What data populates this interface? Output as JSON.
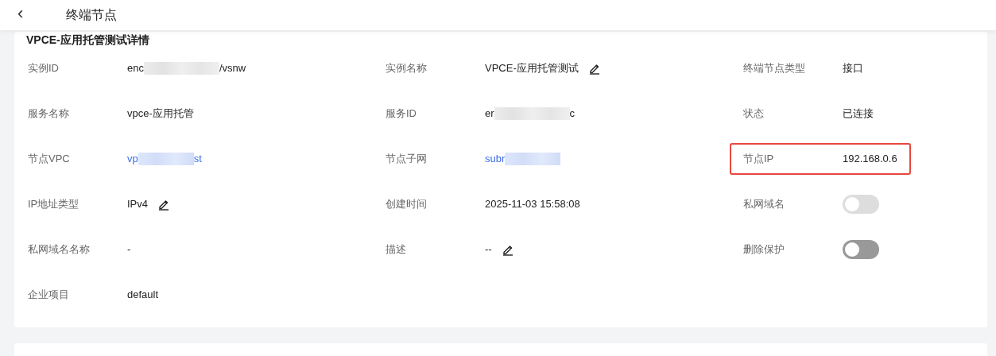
{
  "header": {
    "back_icon": "‹",
    "title": "终端节点"
  },
  "card": {
    "title": "VPCE-应用托管测试详情",
    "fields": [
      {
        "label": "实例ID",
        "kind": "masked",
        "value": "enc",
        "value_end": "/vsnw",
        "editable": false,
        "highlighted": false
      },
      {
        "label": "实例名称",
        "kind": "text",
        "value": "VPCE-应用托管测试",
        "editable": true,
        "highlighted": false
      },
      {
        "label": "终端节点类型",
        "kind": "text",
        "value": "接口",
        "editable": false,
        "highlighted": false
      },
      {
        "label": "服务名称",
        "kind": "text",
        "value": "vpce-应用托管",
        "editable": false,
        "highlighted": false
      },
      {
        "label": "服务ID",
        "kind": "masked",
        "value": "er",
        "value_end": "c",
        "editable": false,
        "highlighted": false
      },
      {
        "label": "状态",
        "kind": "text",
        "value": "已连接",
        "editable": false,
        "highlighted": false
      },
      {
        "label": "节点VPC",
        "kind": "masked_link",
        "value": "vp",
        "value_end": "st",
        "editable": false,
        "highlighted": false
      },
      {
        "label": "节点子网",
        "kind": "masked_link",
        "value": "subr",
        "editable": false,
        "highlighted": false
      },
      {
        "label": "节点IP",
        "kind": "text",
        "value": "192.168.0.6",
        "editable": false,
        "highlighted": true
      },
      {
        "label": "IP地址类型",
        "kind": "text",
        "value": "IPv4",
        "editable": true,
        "highlighted": false
      },
      {
        "label": "创建时间",
        "kind": "text",
        "value": "2025-11-03 15:58:08",
        "editable": false,
        "highlighted": false
      },
      {
        "label": "私网域名",
        "kind": "toggle",
        "on": false,
        "disabled": true,
        "highlighted": false
      },
      {
        "label": "私网域名名称",
        "kind": "text",
        "value": "-",
        "editable": false,
        "highlighted": false
      },
      {
        "label": "描述",
        "kind": "text",
        "value": "--",
        "editable": true,
        "highlighted": false
      },
      {
        "label": "删除保护",
        "kind": "toggle",
        "on": false,
        "disabled": false,
        "highlighted": false
      },
      {
        "label": "企业项目",
        "kind": "text",
        "value": "default",
        "editable": false,
        "highlighted": false
      }
    ]
  }
}
